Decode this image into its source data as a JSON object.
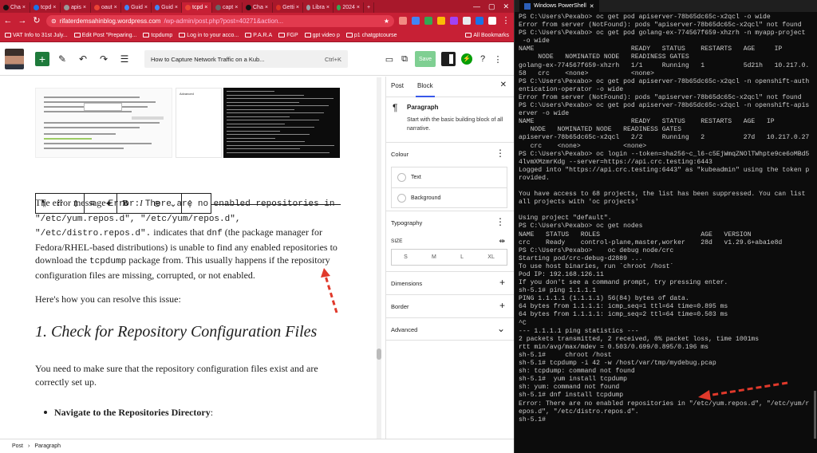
{
  "browser": {
    "tabs": [
      {
        "label": "Cha",
        "color": "#111"
      },
      {
        "label": "tcpd",
        "color": "#1a73e8"
      },
      {
        "label": "apis",
        "color": "#999"
      },
      {
        "label": "oaut",
        "color": "#ea4335"
      },
      {
        "label": "Guid",
        "color": "#4285f4"
      },
      {
        "label": "Guid",
        "color": "#4285f4"
      },
      {
        "label": "tcpd",
        "color": "#ea4335"
      },
      {
        "label": "capt",
        "color": "#666"
      },
      {
        "label": "Cha",
        "color": "#111"
      },
      {
        "label": "Getti",
        "color": "#d93025"
      },
      {
        "label": "Libra",
        "color": "#9aa0a6"
      },
      {
        "label": "2024",
        "color": "#34a853"
      }
    ],
    "url_host": "rifaterdemsahinblog.wordpress.com",
    "url_path": "/wp-admin/post.php?post=40271&action...",
    "bookmarks": [
      "VAT Info to 31st July...",
      "Edit Post \"Preparing...",
      "tcpdump",
      "Log in to your acco...",
      "P.A.R.A",
      "FGP",
      "gpt video p",
      "p1 chatgptcourse"
    ],
    "all_bookmarks": "All Bookmarks"
  },
  "editor": {
    "command_bar": "How to Capture Network Traffic on a Kub...",
    "shortcut": "Ctrl+K",
    "save_label": "Save",
    "para1_a": "The error message ",
    "para1_code1": "Error: There are no enabled repositories in \"/etc/yum.repos.d\", \"/etc/yum/repos.d\", \"/etc/distro.repos.d\".",
    "para1_b": " indicates that ",
    "para1_code2": "dnf",
    "para1_c": " (the package manager for Fedora/RHEL-based distributions) is unable to find any enabled repositories to download the ",
    "para1_code3": "tcpdump",
    "para1_d": " package from. This usually happens if the repository configuration files are missing, corrupted, or not enabled.",
    "para2": "Here's how you can resolve this issue:",
    "heading": "1. Check for Repository Configuration Files",
    "para3": "You need to make sure that the repository configuration files exist and are correctly set up.",
    "bullet_bold": "Navigate to the Repositories Directory",
    "bullet_rest": ":",
    "image_mid_label": "Advanced"
  },
  "sidebar": {
    "tab_post": "Post",
    "tab_block": "Block",
    "block_name": "Paragraph",
    "block_desc": "Start with the basic building block of all narrative.",
    "colour": "Colour",
    "text": "Text",
    "background": "Background",
    "typography": "Typography",
    "size": "SIZE",
    "sizes": [
      "S",
      "M",
      "L",
      "XL"
    ],
    "dimensions": "Dimensions",
    "border": "Border",
    "advanced": "Advanced"
  },
  "footer": {
    "crumb1": "Post",
    "sep": "›",
    "crumb2": "Paragraph"
  },
  "powershell": {
    "title": "Windows PowerShell",
    "lines": [
      "PS C:\\Users\\Pexabo> oc get pod apiserver-78b65dc65c-x2qcl -o wide",
      "Error from server (NotFound): pods \"apiserver-78b65dc65c-x2qcl\" not found",
      "PS C:\\Users\\Pexabo> oc get pod golang-ex-774567f659-xhzrh -n myapp-project",
      " -o wide",
      "NAME                         READY   STATUS    RESTARTS   AGE     IP",
      "     NODE   NOMINATED NODE   READINESS GATES",
      "golang-ex-774567f659-xhzrh   1/1     Running   1          5d21h   10.217.0.",
      "58   crc    <none>           <none>",
      "PS C:\\Users\\Pexabo> oc get pod apiserver-78b65dc65c-x2qcl -n openshift-auth",
      "entication-operator -o wide",
      "Error from server (NotFound): pods \"apiserver-78b65dc65c-x2qcl\" not found",
      "PS C:\\Users\\Pexabo> oc get pod apiserver-78b65dc65c-x2qcl -n openshift-apis",
      "erver -o wide",
      "NAME                         READY   STATUS    RESTARTS   AGE   IP",
      "   NODE   NOMINATED NODE   READINESS GATES",
      "apiserver-78b65dc65c-x2qcl   2/2     Running   2          27d   10.217.0.27",
      "   crc    <none>           <none>",
      "PS C:\\Users\\Pexabo> oc login --token=sha256~c_l6-c5EjWmqZNOlTWhpte9ce6oMBd5",
      "4lvmXMzmrKdg --server=https://api.crc.testing:6443",
      "Logged into \"https://api.crc.testing:6443\" as \"kubeadmin\" using the token p",
      "rovided.",
      "",
      "You have access to 68 projects, the list has been suppressed. You can list",
      "all projects with 'oc projects'",
      "",
      "Using project \"default\".",
      "PS C:\\Users\\Pexabo> oc get nodes",
      "NAME   STATUS   ROLES                          AGE   VERSION",
      "crc    Ready    control-plane,master,worker    28d   v1.29.6+aba1e8d",
      "PS C:\\Users\\Pexabo>    oc debug node/crc",
      "Starting pod/crc-debug-d2889 ...",
      "To use host binaries, run `chroot /host`",
      "Pod IP: 192.168.126.11",
      "If you don't see a command prompt, try pressing enter.",
      "sh-5.1# ping 1.1.1.1",
      "PING 1.1.1.1 (1.1.1.1) 56(84) bytes of data.",
      "64 bytes from 1.1.1.1: icmp_seq=1 ttl=64 time=0.895 ms",
      "64 bytes from 1.1.1.1: icmp_seq=2 ttl=64 time=0.503 ms",
      "^C",
      "--- 1.1.1.1 ping statistics ---",
      "2 packets transmitted, 2 received, 0% packet loss, time 1001ms",
      "rtt min/avg/max/mdev = 0.503/0.699/0.895/0.196 ms",
      "sh-5.1#     chroot /host",
      "sh-5.1# tcpdump -i 42 -w /host/var/tmp/mydebug.pcap",
      "sh: tcpdump: command not found",
      "sh-5.1#  yum install tcpdump",
      "sh: yum: command not found",
      "sh-5.1# dnf install tcpdump",
      "Error: There are no enabled repositories in \"/etc/yum.repos.d\", \"/etc/yum/r",
      "epos.d\", \"/etc/distro.repos.d\".",
      "sh-5.1#"
    ]
  },
  "colors": {
    "chrome_red": "#c72035",
    "wp_green": "#1e7a3b",
    "wp_blue": "#3858e9",
    "arrow_red": "#e0392b",
    "terminal_bg": "#0c0c0c"
  }
}
